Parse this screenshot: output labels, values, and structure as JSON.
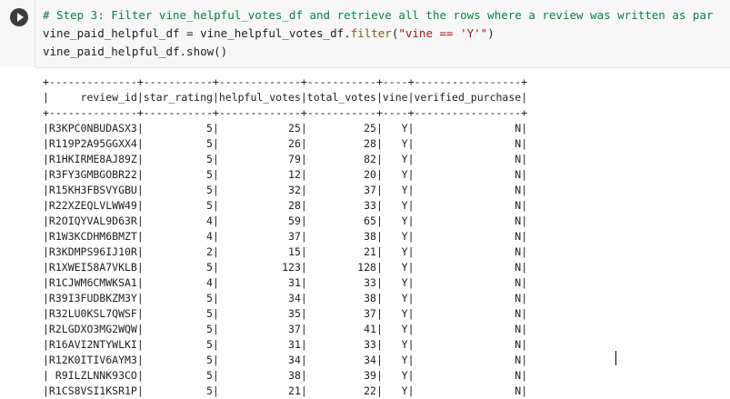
{
  "code_cell": {
    "lines": [
      [
        {
          "t": "# Step 3: Filter vine_helpful_votes_df and retrieve all the rows where a review was written as par",
          "c": "comment"
        }
      ],
      [
        {
          "t": "vine_paid_helpful_df = vine_helpful_votes_df.",
          "c": "ident"
        },
        {
          "t": "filter",
          "c": "method"
        },
        {
          "t": "(",
          "c": "ident"
        },
        {
          "t": "\"vine == 'Y'\"",
          "c": "str"
        },
        {
          "t": ")",
          "c": "ident"
        }
      ],
      [
        {
          "t": "vine_paid_helpful_df.show()",
          "c": "ident"
        }
      ]
    ]
  },
  "output": {
    "lines": [
      "+--------------+-----------+-------------+-----------+----+-----------------+",
      "|     review_id|star_rating|helpful_votes|total_votes|vine|verified_purchase|",
      "+--------------+-----------+-------------+-----------+----+-----------------+",
      "|R3KPC0NBUDASX3|          5|           25|         25|   Y|                N|",
      "|R119P2A95GGXX4|          5|           26|         28|   Y|                N|",
      "|R1HKIRME8AJ89Z|          5|           79|         82|   Y|                N|",
      "|R3FY3GMBGOBR22|          5|           12|         20|   Y|                N|",
      "|R15KH3FBSVYGBU|          5|           32|         37|   Y|                N|",
      "|R22XZEQLVLWW49|          5|           28|         33|   Y|                N|",
      "|R2OIQYVAL9D63R|          4|           59|         65|   Y|                N|",
      "|R1W3KCDHM6BMZT|          4|           37|         38|   Y|                N|",
      "|R3KDMPS96IJ10R|          2|           15|         21|   Y|                N|",
      "|R1XWEI58A7VKLB|          5|          123|        128|   Y|                N|",
      "|R1CJWM6CMWKSA1|          4|           31|         33|   Y|                N|",
      "|R39I3FUDBKZM3Y|          5|           34|         38|   Y|                N|",
      "|R32LU0KSL7QWSF|          5|           35|         37|   Y|                N|",
      "|R2LGDXO3MG2WQW|          5|           37|         41|   Y|                N|",
      "|R16AVI2NTYWLKI|          5|           31|         33|   Y|                N|",
      "|R12K0ITIV6AYM3|          5|           34|         34|   Y|                N|",
      "| R9ILZLNNK93CO|          5|           38|         39|   Y|                N|",
      "|R1CS8VSI1KSR1P|          5|           21|         22|   Y|                N|"
    ]
  }
}
